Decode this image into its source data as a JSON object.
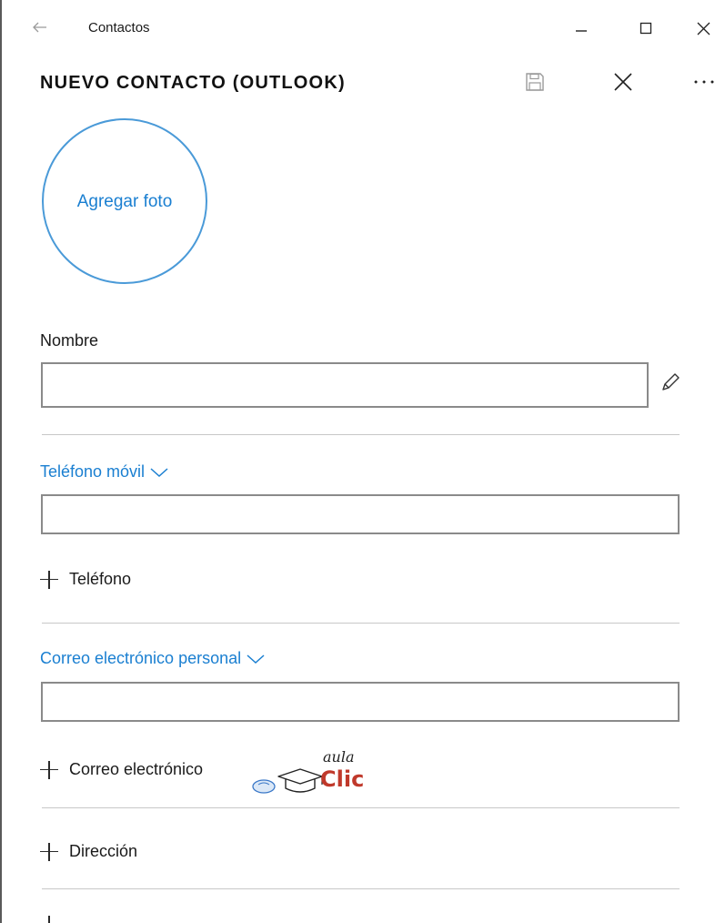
{
  "window": {
    "title": "Contactos",
    "back_icon": "back-arrow-icon",
    "minimize_icon": "minimize-icon",
    "maximize_icon": "maximize-icon",
    "close_icon": "close-icon"
  },
  "header": {
    "title": "NUEVO CONTACTO (OUTLOOK)",
    "save_icon": "save-icon",
    "cancel_icon": "close-icon",
    "more_icon": "more-icon"
  },
  "photo": {
    "label": "Agregar foto"
  },
  "name": {
    "label": "Nombre",
    "value": "",
    "edit_icon": "pencil-icon"
  },
  "phone": {
    "label": "Teléfono móvil",
    "value": "",
    "add_label": "Teléfono"
  },
  "email": {
    "label": "Correo electrónico personal",
    "value": "",
    "add_label": "Correo electrónico"
  },
  "address": {
    "add_label": "Dirección"
  },
  "watermark": {
    "line1": "aula",
    "line2": "Clic"
  },
  "colors": {
    "accent": "#1a7fd1",
    "circle": "#4a9ad8",
    "divider": "#c8c8c8",
    "logo_red": "#c0392b"
  }
}
